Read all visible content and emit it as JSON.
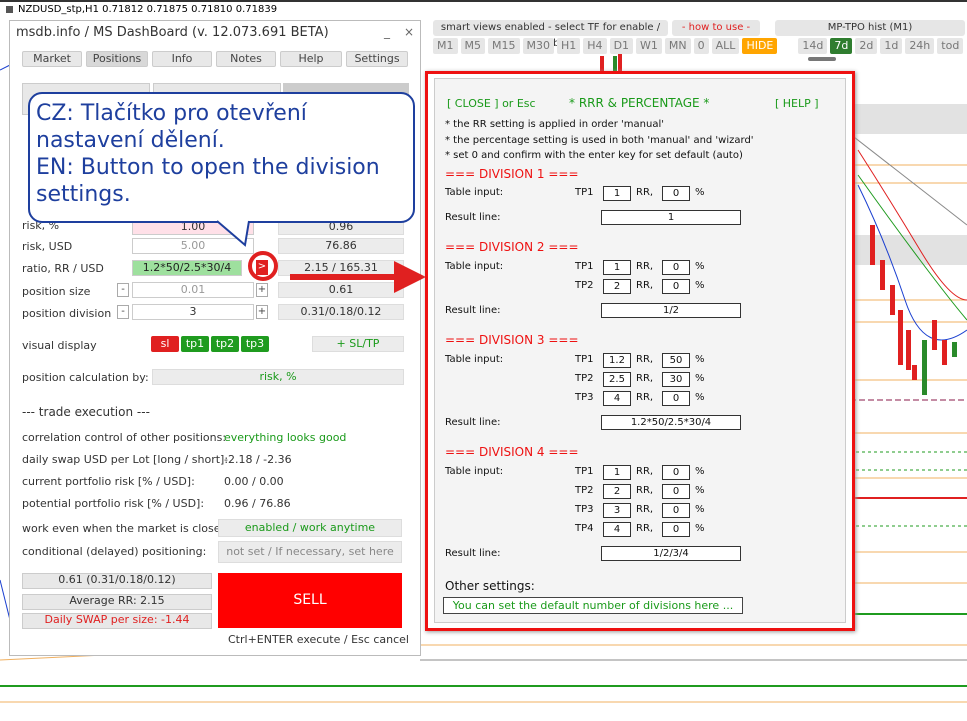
{
  "chart": {
    "symbol_line": "NZDUSD_stp,H1  0.71812 0.71875 0.71810 0.71839",
    "header_tabs": {
      "smart_views": "smart views enabled - select TF for enable / disable",
      "how_to_use": "- how to use -",
      "mp_tpo": "MP-TPO hist (M1)"
    },
    "timeframes": [
      "M1",
      "M5",
      "M15",
      "M30",
      "H1",
      "H4",
      "D1",
      "W1",
      "MN",
      "0",
      "ALL",
      "HIDE",
      "14d",
      "7d",
      "2d",
      "1d",
      "24h",
      "tod"
    ],
    "colors": {
      "hide": "#ffa500",
      "selected": "#2f7d2f",
      "up_candle": "#2a8a2a",
      "down_candle": "#e02020"
    }
  },
  "dashboard": {
    "title": "msdb.info / MS DashBoard (v. 12.073.691 BETA)",
    "controls": {
      "minimize": "_",
      "close": "×"
    },
    "tabs": [
      "Market",
      "Positions",
      "Info",
      "Notes",
      "Help",
      "Settings"
    ],
    "active_tab": "Positions",
    "rows": {
      "risk_pct_label": "risk, %",
      "risk_pct_value": "1.00",
      "risk_pct_right": "0.96",
      "risk_usd_label": "risk, USD",
      "risk_usd_value": "5.00",
      "risk_usd_right": "76.86",
      "ratio_label": "ratio, RR / USD",
      "ratio_value": "1.2*50/2.5*30/4",
      "ratio_button": ">",
      "ratio_right": "2.15 / 165.31",
      "pos_size_label": "position size",
      "pos_size_value": "0.01",
      "pos_size_right": "0.61",
      "pos_div_label": "position division",
      "pos_div_value": "3",
      "pos_div_right": "0.31/0.18/0.12",
      "minus": "-",
      "plus": "+"
    },
    "visual_display": {
      "label": "visual display",
      "chips": [
        "sl",
        "tp1",
        "tp2",
        "tp3"
      ],
      "sltp": "+ SL/TP",
      "colors": {
        "sl": "#e02020",
        "tp": "#1f9b1f"
      }
    },
    "calc_by": {
      "label": "position calculation by:",
      "value": "risk, %"
    },
    "trade_exec": {
      "heading": "--- trade execution ---",
      "correlation_label": "correlation control of other positions:",
      "correlation_value": "everything looks good",
      "swap_label": "daily swap USD per Lot [long / short]:",
      "swap_value": "-2.18 / -2.36",
      "current_risk_label": "current portfolio risk [% / USD]:",
      "current_risk_value": "0.00 / 0.00",
      "potential_risk_label": "potential portfolio risk [% / USD]:",
      "potential_risk_value": "0.96 / 76.86",
      "closed_label": "work even when the market is closed:",
      "closed_value": "enabled / work anytime",
      "delayed_label": "conditional (delayed) positioning:",
      "delayed_value": "not set / If necessary, set here"
    },
    "summary": {
      "lots": "0.61 (0.31/0.18/0.12)",
      "avg_rr": "Average RR: 2.15",
      "daily_swap": "Daily SWAP per size: -1.44"
    },
    "sell": {
      "label": "SELL",
      "hint": "Ctrl+ENTER execute / Esc cancel"
    }
  },
  "callout": {
    "cz": "CZ: Tlačítko pro otevření nastavení dělení.",
    "en": "EN: Button to open the division settings."
  },
  "popup": {
    "close": "[ CLOSE ] or Esc",
    "title": "* RRR & PERCENTAGE *",
    "help": "[ HELP ]",
    "notes": [
      "* the RR setting is applied in order 'manual'",
      "* the percentage setting is used in both 'manual' and 'wizard'",
      "* set 0 and confirm with the enter key for set default (auto)"
    ],
    "table_input": "Table input:",
    "result_line": "Result line:",
    "rr": "RR,",
    "pct": "%",
    "divisions": [
      {
        "title": "=== DIVISION 1 ===",
        "rows": [
          {
            "tp": "TP1",
            "rr": "1",
            "pct": "0"
          }
        ],
        "result": "1"
      },
      {
        "title": "=== DIVISION 2 ===",
        "rows": [
          {
            "tp": "TP1",
            "rr": "1",
            "pct": "0"
          },
          {
            "tp": "TP2",
            "rr": "2",
            "pct": "0"
          }
        ],
        "result": "1/2"
      },
      {
        "title": "=== DIVISION 3 ===",
        "rows": [
          {
            "tp": "TP1",
            "rr": "1.2",
            "pct": "50"
          },
          {
            "tp": "TP2",
            "rr": "2.5",
            "pct": "30"
          },
          {
            "tp": "TP3",
            "rr": "4",
            "pct": "0"
          }
        ],
        "result": "1.2*50/2.5*30/4"
      },
      {
        "title": "=== DIVISION 4 ===",
        "rows": [
          {
            "tp": "TP1",
            "rr": "1",
            "pct": "0"
          },
          {
            "tp": "TP2",
            "rr": "2",
            "pct": "0"
          },
          {
            "tp": "TP3",
            "rr": "3",
            "pct": "0"
          },
          {
            "tp": "TP4",
            "rr": "4",
            "pct": "0"
          }
        ],
        "result": "1/2/3/4"
      }
    ],
    "other_settings": "Other settings:",
    "default_btn": "You can set the default number of divisions here ..."
  }
}
